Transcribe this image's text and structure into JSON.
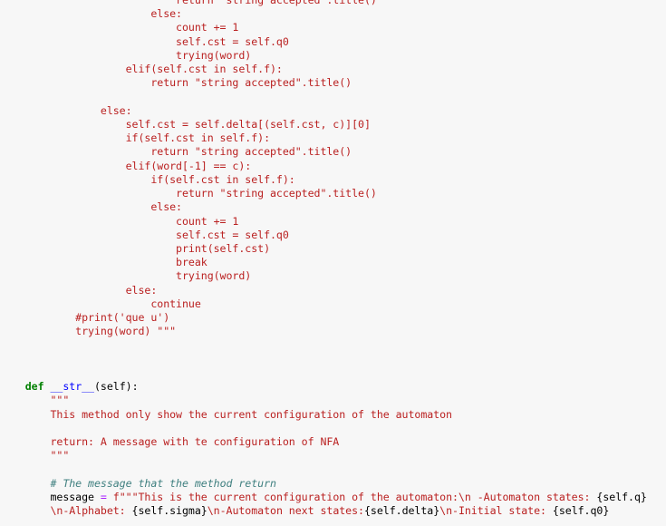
{
  "editor": {
    "background": "#f7f7f7",
    "colors": {
      "string": "#ba2121",
      "keyword": "#008000",
      "function_name": "#0000ff",
      "operator": "#aa22ff",
      "comment": "#408080",
      "plain": "#000000"
    },
    "lines": [
      {
        "indent": "                            ",
        "tokens": [
          {
            "t": "str",
            "v": "return \"string accepted\".title()"
          }
        ]
      },
      {
        "indent": "                        ",
        "tokens": [
          {
            "t": "str",
            "v": "else:"
          }
        ]
      },
      {
        "indent": "                            ",
        "tokens": [
          {
            "t": "str",
            "v": "count += 1"
          }
        ]
      },
      {
        "indent": "                            ",
        "tokens": [
          {
            "t": "str",
            "v": "self.cst = self.q0"
          }
        ]
      },
      {
        "indent": "                            ",
        "tokens": [
          {
            "t": "str",
            "v": "trying(word)"
          }
        ]
      },
      {
        "indent": "                    ",
        "tokens": [
          {
            "t": "str",
            "v": "elif(self.cst in self.f):"
          }
        ]
      },
      {
        "indent": "                        ",
        "tokens": [
          {
            "t": "str",
            "v": "return \"string accepted\".title()"
          }
        ]
      },
      {
        "indent": "",
        "tokens": []
      },
      {
        "indent": "                ",
        "tokens": [
          {
            "t": "str",
            "v": "else:"
          }
        ]
      },
      {
        "indent": "                    ",
        "tokens": [
          {
            "t": "str",
            "v": "self.cst = self.delta[(self.cst, c)][0]"
          }
        ]
      },
      {
        "indent": "                    ",
        "tokens": [
          {
            "t": "str",
            "v": "if(self.cst in self.f):"
          }
        ]
      },
      {
        "indent": "                        ",
        "tokens": [
          {
            "t": "str",
            "v": "return \"string accepted\".title()"
          }
        ]
      },
      {
        "indent": "                    ",
        "tokens": [
          {
            "t": "str",
            "v": "elif(word[-1] == c):"
          }
        ]
      },
      {
        "indent": "                        ",
        "tokens": [
          {
            "t": "str",
            "v": "if(self.cst in self.f):"
          }
        ]
      },
      {
        "indent": "                            ",
        "tokens": [
          {
            "t": "str",
            "v": "return \"string accepted\".title()"
          }
        ]
      },
      {
        "indent": "                        ",
        "tokens": [
          {
            "t": "str",
            "v": "else:"
          }
        ]
      },
      {
        "indent": "                            ",
        "tokens": [
          {
            "t": "str",
            "v": "count += 1"
          }
        ]
      },
      {
        "indent": "                            ",
        "tokens": [
          {
            "t": "str",
            "v": "self.cst = self.q0"
          }
        ]
      },
      {
        "indent": "                            ",
        "tokens": [
          {
            "t": "str",
            "v": "print(self.cst)"
          }
        ]
      },
      {
        "indent": "                            ",
        "tokens": [
          {
            "t": "str",
            "v": "break"
          }
        ]
      },
      {
        "indent": "                            ",
        "tokens": [
          {
            "t": "str",
            "v": "trying(word)"
          }
        ]
      },
      {
        "indent": "                    ",
        "tokens": [
          {
            "t": "str",
            "v": "else:"
          }
        ]
      },
      {
        "indent": "                        ",
        "tokens": [
          {
            "t": "str",
            "v": "continue"
          }
        ]
      },
      {
        "indent": "            ",
        "tokens": [
          {
            "t": "str",
            "v": "#print('que u')"
          }
        ]
      },
      {
        "indent": "            ",
        "tokens": [
          {
            "t": "str",
            "v": "trying(word) \"\"\""
          }
        ]
      },
      {
        "indent": "",
        "tokens": []
      },
      {
        "indent": "",
        "tokens": []
      },
      {
        "indent": "",
        "tokens": []
      },
      {
        "indent": "    ",
        "tokens": [
          {
            "t": "kw",
            "v": "def"
          },
          {
            "t": "plain",
            "v": " "
          },
          {
            "t": "fn",
            "v": "__str__"
          },
          {
            "t": "plain",
            "v": "(self):"
          }
        ]
      },
      {
        "indent": "        ",
        "tokens": [
          {
            "t": "str",
            "v": "\"\"\""
          }
        ]
      },
      {
        "indent": "        ",
        "tokens": [
          {
            "t": "str",
            "v": "This method only show the current configuration of the automaton"
          }
        ]
      },
      {
        "indent": "",
        "tokens": []
      },
      {
        "indent": "        ",
        "tokens": [
          {
            "t": "str",
            "v": "return: A message with te configuration of NFA"
          }
        ]
      },
      {
        "indent": "        ",
        "tokens": [
          {
            "t": "str",
            "v": "\"\"\""
          }
        ]
      },
      {
        "indent": "",
        "tokens": []
      },
      {
        "indent": "        ",
        "tokens": [
          {
            "t": "cm",
            "v": "# The message that the method return"
          }
        ]
      },
      {
        "indent": "        ",
        "tokens": [
          {
            "t": "plain",
            "v": "message "
          },
          {
            "t": "op",
            "v": "="
          },
          {
            "t": "plain",
            "v": " "
          },
          {
            "t": "str",
            "v": "f\"\"\"This is the current configuration of the automaton:\\n -Automaton states: "
          },
          {
            "t": "plain",
            "v": "{self.q}"
          }
        ]
      },
      {
        "indent": "        ",
        "tokens": [
          {
            "t": "str",
            "v": "\\n-Alphabet: "
          },
          {
            "t": "plain",
            "v": "{self.sigma}"
          },
          {
            "t": "str",
            "v": "\\n-Automaton next states:"
          },
          {
            "t": "plain",
            "v": "{self.delta}"
          },
          {
            "t": "str",
            "v": "\\n-Initial state: "
          },
          {
            "t": "plain",
            "v": "{self.q0}"
          }
        ]
      }
    ]
  }
}
